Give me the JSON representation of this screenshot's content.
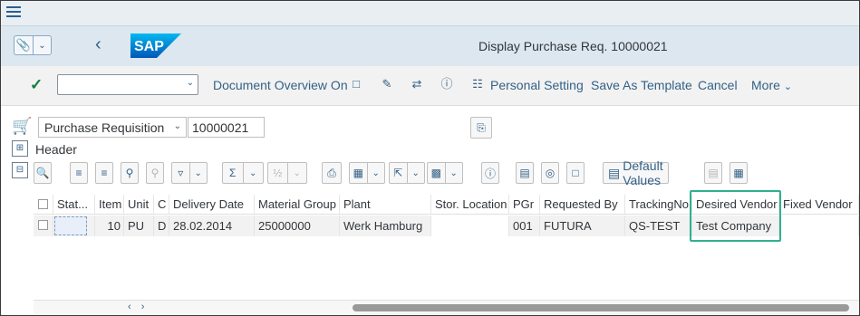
{
  "menu": {
    "icon": "hamburger-icon"
  },
  "shell": {
    "title": "Display Purchase Req. 10000021",
    "logo_text": "SAP",
    "brand_color": "#0a6ed1"
  },
  "toolbar": {
    "command_value": "",
    "document_overview": "Document Overview On",
    "personal_setting": "Personal Setting",
    "save_as_template": "Save As Template",
    "cancel": "Cancel",
    "more": "More"
  },
  "header": {
    "doc_type": "Purchase Requisition",
    "doc_number": "10000021",
    "header_label": "Header"
  },
  "item_toolbar": {
    "default_values": "Default Values"
  },
  "table": {
    "columns": [
      "Stat...",
      "Item",
      "Unit",
      "C",
      "Delivery Date",
      "Material Group",
      "Plant",
      "Stor. Location",
      "PGr",
      "Requested By",
      "TrackingNo",
      "Desired Vendor",
      "Fixed Vendor"
    ],
    "rows": [
      {
        "status": "",
        "item": "10",
        "unit": "PU",
        "c": "D",
        "delivery_date": "28.02.2014",
        "material_group": "25000000",
        "plant": "Werk Hamburg",
        "stor_location": "",
        "pgr": "001",
        "requested_by": "FUTURA",
        "tracking_no": "QS-TEST",
        "desired_vendor": "Test Company",
        "fixed_vendor": ""
      }
    ],
    "highlight_color": "#2fb18e"
  },
  "scroll": {
    "arrows": "‹ ›"
  }
}
